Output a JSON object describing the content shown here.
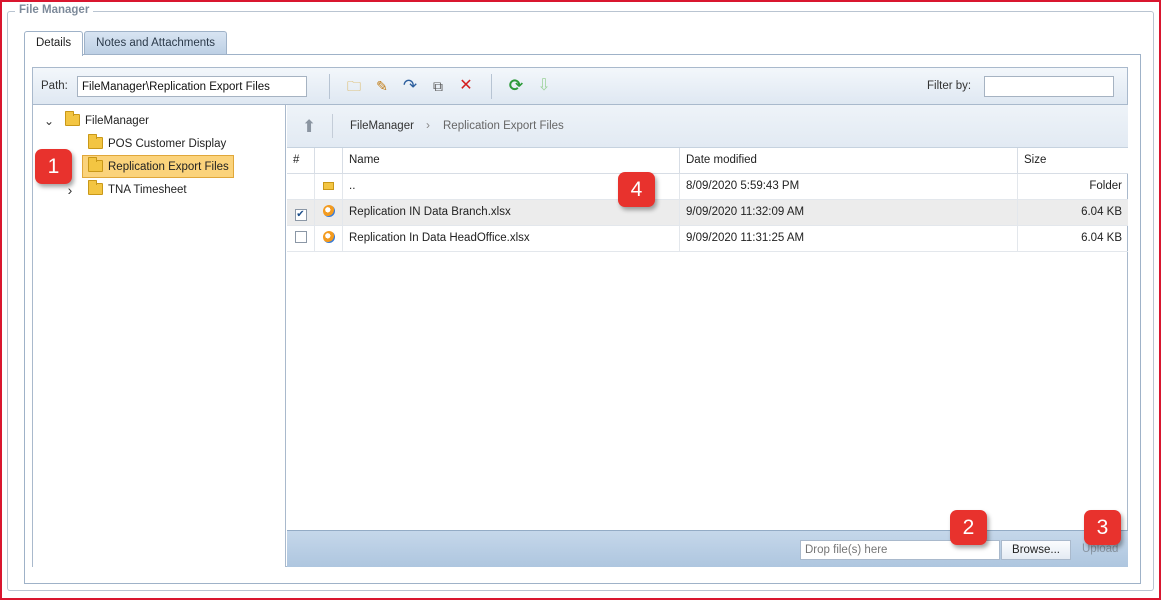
{
  "panel": {
    "title": "File Manager"
  },
  "tabs": [
    {
      "label": "Details",
      "active": true
    },
    {
      "label": "Notes and Attachments",
      "active": false
    }
  ],
  "toolbar": {
    "path_label": "Path:",
    "path_value": "FileManager\\Replication Export Files",
    "filter_label": "Filter by:",
    "filter_value": "",
    "buttons": [
      {
        "name": "new-folder-icon",
        "glyph": "🗀"
      },
      {
        "name": "rename-icon",
        "glyph": "✎"
      },
      {
        "name": "move-icon",
        "glyph": "↷"
      },
      {
        "name": "copy-icon",
        "glyph": "⧉"
      },
      {
        "name": "delete-icon",
        "glyph": "✕"
      },
      {
        "name": "refresh-icon",
        "glyph": "⟳"
      },
      {
        "name": "download-icon",
        "glyph": "⇩"
      }
    ]
  },
  "tree": {
    "root": "FileManager",
    "children": [
      "POS Customer Display",
      "Replication Export Files",
      "TNA Timesheet"
    ],
    "selected": "Replication Export Files",
    "expanded_glyph": "⌄",
    "collapsed_glyph": "›"
  },
  "breadcrumb": {
    "items": [
      "FileManager",
      "Replication Export Files"
    ],
    "separator": "›"
  },
  "grid": {
    "columns": [
      "#",
      "",
      "Name",
      "Date modified",
      "Size"
    ],
    "rows": [
      {
        "checked": false,
        "icon": "folder",
        "name": "..",
        "date": "8/09/2020 5:59:43 PM",
        "size": "Folder",
        "has_checkbox": false
      },
      {
        "checked": true,
        "icon": "xlsx",
        "name": "Replication IN Data Branch.xlsx",
        "date": "9/09/2020 11:32:09 AM",
        "size": "6.04 KB",
        "has_checkbox": true
      },
      {
        "checked": false,
        "icon": "xlsx",
        "name": "Replication In Data HeadOffice.xlsx",
        "date": "9/09/2020 11:31:25 AM",
        "size": "6.04 KB",
        "has_checkbox": true
      }
    ]
  },
  "upload": {
    "drop_placeholder": "Drop file(s) here",
    "browse_label": "Browse...",
    "upload_label": "Upload"
  },
  "callouts": [
    "1",
    "2",
    "3",
    "4"
  ],
  "colors": {
    "accent_red": "#e8322d",
    "frame_red": "#d9162f",
    "selection": "#fbd37b",
    "toolbar_blue": "#c5d7ea"
  }
}
